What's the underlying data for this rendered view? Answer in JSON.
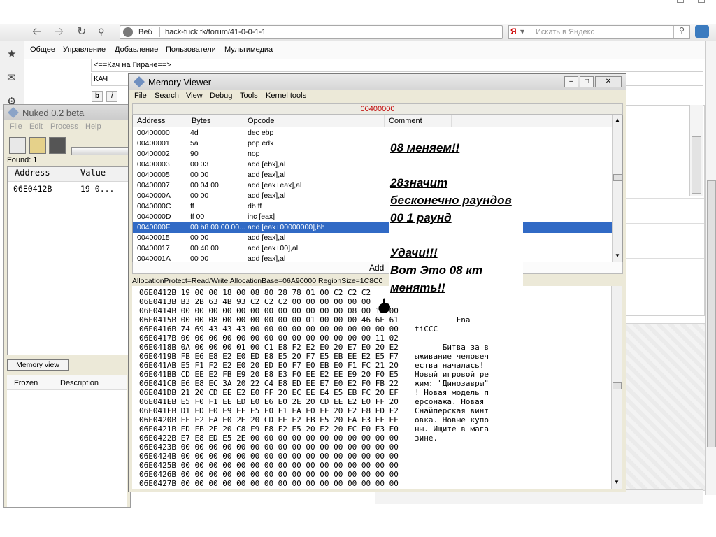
{
  "browser": {
    "url_prefix": "Веб",
    "url": "hack-fuck.tk/forum/41-0-0-1-1",
    "yandex_label": "Я",
    "search_placeholder": "Искать в Яндекс"
  },
  "forum": {
    "nav": [
      "Общее",
      "Управление",
      "Добавление",
      "Пользователи",
      "Мультимедиа"
    ],
    "title_field": "<==Кач на Гиране==>",
    "subtitle_field": "КАЧ",
    "format_buttons": [
      "b",
      "i"
    ]
  },
  "nuked": {
    "title": "Nuked 0.2 beta",
    "menu": [
      "File",
      "Edit",
      "Process",
      "Help"
    ],
    "found_label": "Found: 1",
    "columns": [
      "Address",
      "Value"
    ],
    "result": {
      "address": "06E0412B",
      "value": "19 0..."
    },
    "memory_view_button": "Memory view",
    "frozen_columns": [
      "Frozen",
      "Description"
    ]
  },
  "memory_viewer": {
    "title": "Memory Viewer",
    "menu": [
      "File",
      "Search",
      "View",
      "Debug",
      "Tools",
      "Kernel tools"
    ],
    "top_address": "00400000",
    "columns": [
      "Address",
      "Bytes",
      "Opcode",
      "Comment"
    ],
    "rows": [
      {
        "address": "00400000",
        "bytes": "4d",
        "opcode": "dec ebp"
      },
      {
        "address": "00400001",
        "bytes": "5a",
        "opcode": "pop edx"
      },
      {
        "address": "00400002",
        "bytes": "90",
        "opcode": "nop"
      },
      {
        "address": "00400003",
        "bytes": "00 03",
        "opcode": "add [ebx],al"
      },
      {
        "address": "00400005",
        "bytes": "00 00",
        "opcode": "add [eax],al"
      },
      {
        "address": "00400007",
        "bytes": "00 04 00",
        "opcode": "add [eax+eax],al"
      },
      {
        "address": "0040000A",
        "bytes": "00 00",
        "opcode": "add [eax],al"
      },
      {
        "address": "0040000C",
        "bytes": "ff",
        "opcode": "db ff"
      },
      {
        "address": "0040000D",
        "bytes": "ff 00",
        "opcode": "inc [eax]"
      },
      {
        "address": "0040000F",
        "bytes": "00 b8 00 00 00...",
        "opcode": "add [eax+00000000],bh",
        "selected": true
      },
      {
        "address": "00400015",
        "bytes": "00 00",
        "opcode": "add [eax],al"
      },
      {
        "address": "00400017",
        "bytes": "00 40 00",
        "opcode": "add [eax+00],al"
      },
      {
        "address": "0040001A",
        "bytes": "00 00",
        "opcode": "add [eax],al"
      }
    ],
    "add_label": "Add",
    "alloc_info": "AllocationProtect=Read/Write  AllocationBase=06A90000  RegionSize=1C8C0",
    "hex_lines": [
      {
        "addr": "06E0412B",
        "bytes": "19 00 00 18 00 08 80 28 78 01 00 C2 C2 C2",
        "ascii": ""
      },
      {
        "addr": "06E0413B",
        "bytes": "B3 2B 63 4B 93 C2 C2 C2 00 00 00 00 00 00",
        "ascii": ""
      },
      {
        "addr": "06E0414B",
        "bytes": "00 00 00 00 00 00 00 00 00 00 00 00 08 00 10 00",
        "ascii": ""
      },
      {
        "addr": "06E0415B",
        "bytes": "00 00 08 00 00 00 00 00 00 01 00 00 00 46 6E 61",
        "ascii": "         Fna"
      },
      {
        "addr": "06E0416B",
        "bytes": "74 69 43 43 43 00 00 00 00 00 00 00 00 00 00 00",
        "ascii": "tiCCC"
      },
      {
        "addr": "06E0417B",
        "bytes": "00 00 00 00 00 00 00 00 00 00 00 00 00 00 11 02",
        "ascii": ""
      },
      {
        "addr": "06E0418B",
        "bytes": "0A 00 00 00 01 00 C1 E8 F2 E2 E0 20 E7 E0 20 E2",
        "ascii": "      Битва за в"
      },
      {
        "addr": "06E0419B",
        "bytes": "FB E6 E8 E2 E0 ED E8 E5 20 F7 E5 EB EE E2 E5 F7",
        "ascii": "ыживание человеч"
      },
      {
        "addr": "06E041AB",
        "bytes": "E5 F1 F2 E2 E0 20 ED E0 F7 E0 EB E0 F1 FC 21 20",
        "ascii": "ества началась! "
      },
      {
        "addr": "06E041BB",
        "bytes": "CD EE E2 FB E9 20 E8 E3 F0 EE E2 EE E9 20 F0 E5",
        "ascii": "Новый игровой ре"
      },
      {
        "addr": "06E041CB",
        "bytes": "E6 E8 EC 3A 20 22 C4 E8 ED EE E7 E0 E2 F0 FB 22",
        "ascii": "жим: \"Динозавры\""
      },
      {
        "addr": "06E041DB",
        "bytes": "21 20 CD EE E2 E0 FF 20 EC EE E4 E5 EB FC 20 EF",
        "ascii": "! Новая модель п"
      },
      {
        "addr": "06E041EB",
        "bytes": "E5 F0 F1 EE ED E0 E6 E0 2E 20 CD EE E2 E0 FF 20",
        "ascii": "ерсонажа. Новая "
      },
      {
        "addr": "06E041FB",
        "bytes": "D1 ED E0 E9 EF E5 F0 F1 EA E0 FF 20 E2 E8 ED F2",
        "ascii": "Снайперская винт"
      },
      {
        "addr": "06E0420B",
        "bytes": "EE E2 EA E0 2E 20 CD EE E2 FB E5 20 EA F3 EF EE",
        "ascii": "овка. Новые купо"
      },
      {
        "addr": "06E0421B",
        "bytes": "ED FB 2E 20 C8 F9 E8 F2 E5 20 E2 20 EC E0 E3 E0",
        "ascii": "ны. Ищите в мага"
      },
      {
        "addr": "06E0422B",
        "bytes": "E7 E8 ED E5 2E 00 00 00 00 00 00 00 00 00 00 00",
        "ascii": "зине."
      },
      {
        "addr": "06E0423B",
        "bytes": "00 00 00 00 00 00 00 00 00 00 00 00 00 00 00 00",
        "ascii": ""
      },
      {
        "addr": "06E0424B",
        "bytes": "00 00 00 00 00 00 00 00 00 00 00 00 00 00 00 00",
        "ascii": ""
      },
      {
        "addr": "06E0425B",
        "bytes": "00 00 00 00 00 00 00 00 00 00 00 00 00 00 00 00",
        "ascii": ""
      },
      {
        "addr": "06E0426B",
        "bytes": "00 00 00 00 00 00 00 00 00 00 00 00 00 00 00 00",
        "ascii": ""
      },
      {
        "addr": "06E0427B",
        "bytes": "00 00 00 00 00 00 00 00 00 00 00 00 00 00 00 00",
        "ascii": ""
      }
    ]
  },
  "annotation": {
    "lines": [
      "08 меняем!!",
      "28значит",
      "бесконечно раундов",
      "00 1 раунд",
      "",
      "Удачи!!!",
      "Вот Это 08 кт",
      "менять!!"
    ]
  },
  "colors": {
    "selection": "#316ac5",
    "address_red": "#c00000",
    "window_bg": "#ece9d8"
  }
}
